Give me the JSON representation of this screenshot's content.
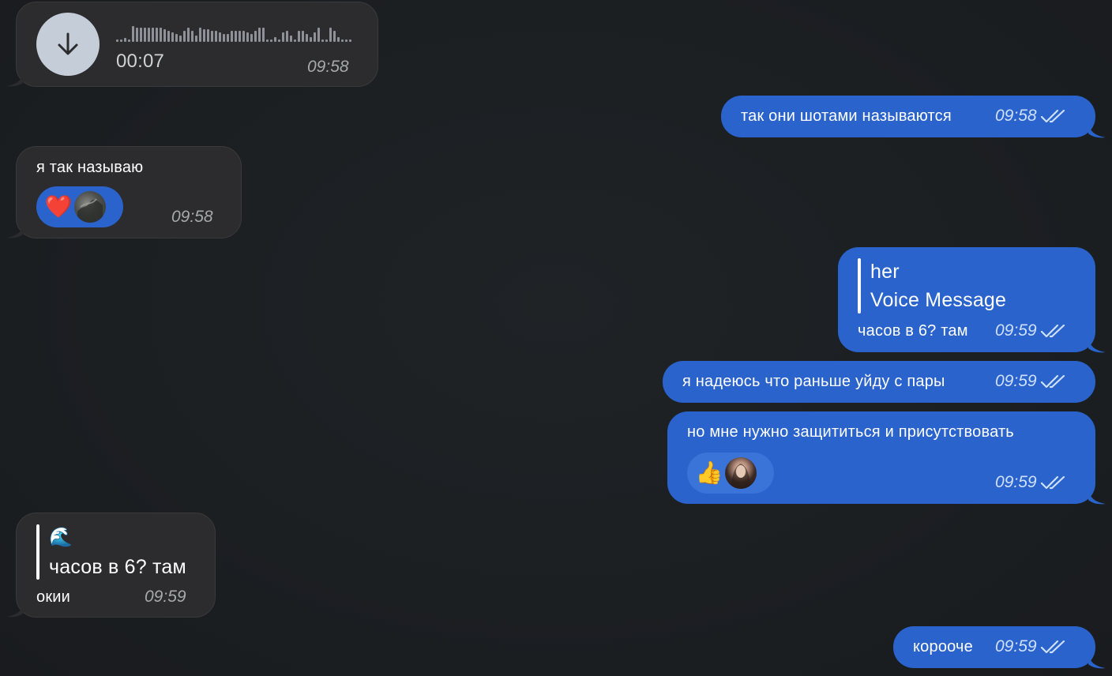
{
  "messages": [
    {
      "id": "m1",
      "direction": "incoming",
      "type": "voice",
      "duration": "00:07",
      "time": "09:58"
    },
    {
      "id": "m2",
      "direction": "outgoing",
      "text": "так они шотами называются",
      "time": "09:58",
      "status": "read"
    },
    {
      "id": "m3",
      "direction": "incoming",
      "text": "я так называю",
      "time": "09:58",
      "reaction": {
        "emoji": "❤️",
        "avatar": "reactor-avatar"
      }
    },
    {
      "id": "m4",
      "direction": "outgoing",
      "reply": {
        "author": "her",
        "preview": "Voice Message"
      },
      "text": "часов в 6? там",
      "time": "09:59",
      "status": "read"
    },
    {
      "id": "m5",
      "direction": "outgoing",
      "text": "я надеюсь что раньше уйду с пары",
      "time": "09:59",
      "status": "read"
    },
    {
      "id": "m6",
      "direction": "outgoing",
      "text": "но мне нужно защититься и присутствовать",
      "time": "09:59",
      "status": "read",
      "reaction": {
        "emoji": "👍",
        "avatar": "reactor-avatar"
      }
    },
    {
      "id": "m7",
      "direction": "incoming",
      "reply": {
        "author": "🌊",
        "preview": "часов в 6? там"
      },
      "text": "окии",
      "time": "09:59"
    },
    {
      "id": "m8",
      "direction": "outgoing",
      "text": "корооче",
      "time": "09:59",
      "status": "read"
    }
  ],
  "colors": {
    "background": "#1c1f22",
    "incoming_bubble": "#2c2c2e",
    "outgoing_bubble": "#2a63cc",
    "reaction_pill_incoming": "#2a63cc",
    "reaction_pill_outgoing": "#3a74d8",
    "voice_download_circle": "#c5cdd8"
  },
  "icons": {
    "download": "arrow-down-icon",
    "read_status": "double-check-icon"
  }
}
